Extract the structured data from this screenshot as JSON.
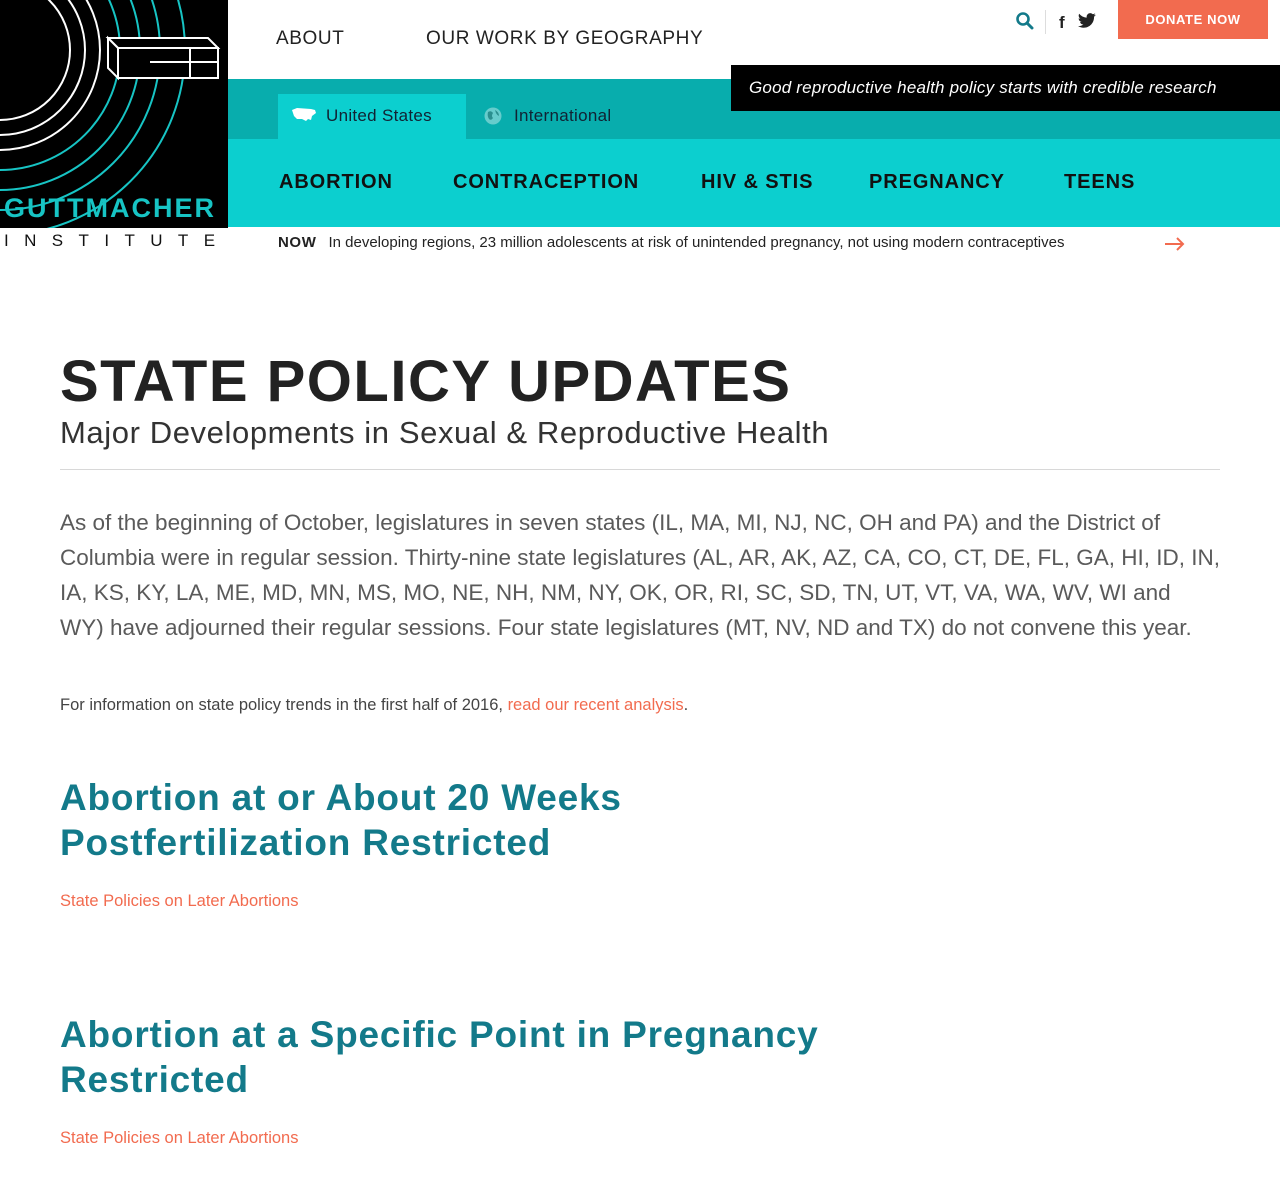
{
  "logo": {
    "wordmark": "GUTTMACHER",
    "sub": "INSTITUTE"
  },
  "nav": {
    "about": "ABOUT",
    "geography": "OUR WORK BY GEOGRAPHY"
  },
  "utility": {
    "search_icon": "search-icon",
    "facebook_icon": "facebook-icon",
    "twitter_icon": "twitter-icon",
    "donate": "DONATE NOW"
  },
  "tagline": "Good reproductive health policy starts with credible research",
  "regions": {
    "us": "United States",
    "international": "International"
  },
  "topics": [
    "ABORTION",
    "CONTRACEPTION",
    "HIV & STIS",
    "PREGNANCY",
    "TEENS"
  ],
  "now": {
    "label": "NOW",
    "text": "In developing regions, 23 million adolescents at risk of unintended pregnancy, not using modern contraceptives"
  },
  "page": {
    "title": "STATE POLICY UPDATES",
    "subtitle": "Major Developments in Sexual & Reproductive Health",
    "intro": "As of the beginning of October, legislatures in seven states (IL, MA, MI, NJ, NC, OH and PA) and the District of Columbia were in regular session. Thirty-nine state legislatures (AL, AR, AK, AZ, CA, CO, CT, DE, FL, GA, HI, ID, IN, IA, KS, KY, LA, ME, MD, MN, MS, MO, NE, NH, NM, NY, OK, OR, RI, SC, SD, TN, UT, VT, VA, WA, WV, WI and WY) have adjourned their regular sessions. Four state legislatures (MT, NV, ND and TX) do not convene this year.",
    "info_prefix": "For information on state policy trends in the first half of 2016, ",
    "info_link": "read our recent analysis",
    "info_suffix": "."
  },
  "sections": [
    {
      "title_line1": "Abortion at or About 20 Weeks",
      "title_line2": "Postfertilization Restricted",
      "link": "State Policies on Later Abortions"
    },
    {
      "title_line1": "Abortion at a Specific Point in Pregnancy",
      "title_line2": "Restricted",
      "link": "State Policies on Later Abortions"
    }
  ],
  "colors": {
    "teal_dark": "#08adad",
    "teal_light": "#0ccfcf",
    "accent": "#f26b4f",
    "heading_teal": "#137a8a"
  }
}
